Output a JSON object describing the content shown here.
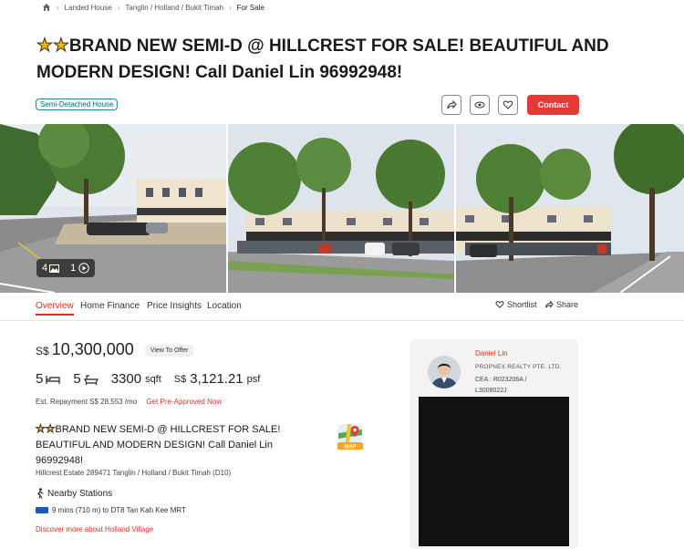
{
  "breadcrumb": {
    "items": [
      "Landed House",
      "Tanglin / Holland / Bukit Timah",
      "For Sale"
    ]
  },
  "listing": {
    "title_line1": "BRAND NEW SEMI-D @ HILLCREST FOR SALE! BEAUTIFUL AND",
    "title_line2": "MODERN DESIGN! Call Daniel Lin 96992948!",
    "property_type": "Semi-Detached House",
    "contact_label": "Contact",
    "photo_count": "4",
    "video_count": "1"
  },
  "tabs": {
    "overview": "Overview",
    "home_finance": "Home Finance",
    "price_insights": "Price Insights",
    "location": "Location",
    "shortlist": "Shortlist",
    "share": "Share"
  },
  "details": {
    "currency": "S$",
    "price": "10,300,000",
    "view_offer": "View To Offer",
    "beds": "5",
    "baths": "5",
    "sqft": "3300",
    "sqft_unit": "sqft",
    "psf_currency": "S$",
    "psf": "3,121.21",
    "psf_unit": "psf",
    "repayment": "Est. Repayment S$ 28,553 /mo",
    "preapproved": "Get Pre-Approved Now",
    "title_line1": "BRAND NEW SEMI-D @ HILLCREST FOR SALE!",
    "title_line2": "BEAUTIFUL AND MODERN DESIGN! Call Daniel Lin",
    "title_line3": "96992948!",
    "address": "Hillcrest Estate 289471 Tanglin / Holland / Bukit Timah (D10)",
    "map_label": "MAP"
  },
  "nearby": {
    "heading": "Nearby Stations",
    "mrt_text": "9 mins (710 m) to DT8 Tan Kah Kee MRT",
    "discover": "Discover more about Holland Village"
  },
  "agent": {
    "name": "Daniel Lin",
    "agency": "PROPNEX REALTY PTE. LTD.",
    "cea_line1": "CEA : R023206A /",
    "cea_line2": "L3008022J"
  },
  "colors": {
    "accent": "#e53935",
    "mrt_line": "#1e5bb8",
    "badge": "#2a8a8a"
  },
  "icons": [
    "home-icon",
    "chevron-right-icon",
    "star-icon",
    "share-icon",
    "eye-icon",
    "heart-icon",
    "image-icon",
    "video-icon",
    "bed-icon",
    "bath-icon",
    "walk-icon",
    "map-icon"
  ]
}
